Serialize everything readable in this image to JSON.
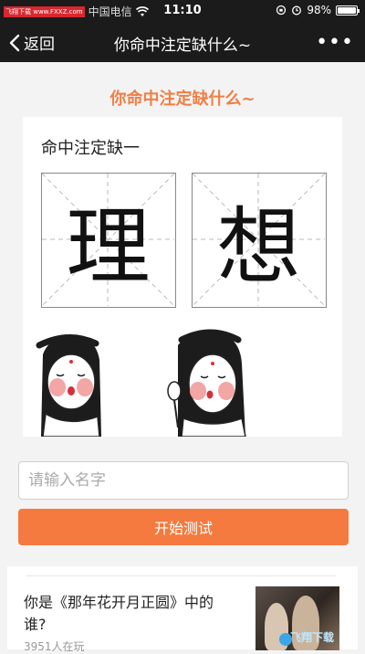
{
  "status_bar": {
    "watermark_tag": "飞翔下载 www.FXXZ.com",
    "carrier": "中国电信",
    "time": "11:10",
    "battery": "98%",
    "battery_level": 0.98
  },
  "nav": {
    "back_label": "返回",
    "title": "你命中注定缺什么~",
    "more_label": "•••"
  },
  "content": {
    "page_title": "你命中注定缺什么~",
    "caption": "命中注定缺一",
    "chars": [
      "理",
      "想"
    ]
  },
  "form": {
    "name_placeholder": "请输入名字",
    "name_value": "",
    "start_label": "开始测试"
  },
  "recommend": {
    "title": "你是《那年花开月正圆》中的谁?",
    "count": "3951人在玩",
    "thumb_watermark": "飞翔下载"
  },
  "colors": {
    "accent": "#f47a3f",
    "title_orange": "#f07f45",
    "bar_bg": "#1b1b1b"
  }
}
